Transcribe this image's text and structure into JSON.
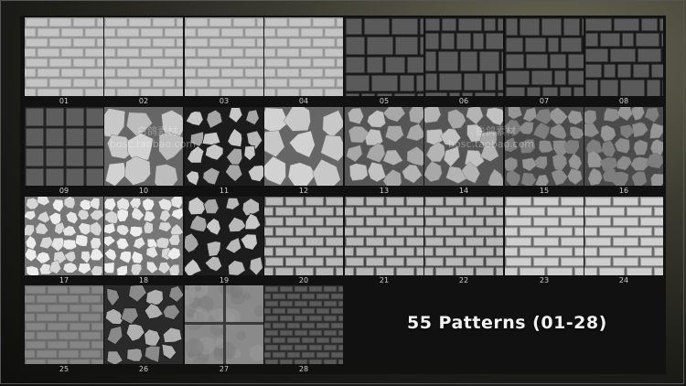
{
  "title": "55 Patterns (01-28)",
  "watermarks": [
    {
      "line1": "白鸽素材",
      "line2": "bosc.taobao.com"
    },
    {
      "line1": "白鸽素材",
      "line2": "bosc.taobao.com"
    }
  ],
  "patterns": [
    {
      "label": "01",
      "style": "brick-light"
    },
    {
      "label": "02",
      "style": "brick-light"
    },
    {
      "label": "03",
      "style": "brick-light"
    },
    {
      "label": "04",
      "style": "brick-light"
    },
    {
      "label": "05",
      "style": "block-dark"
    },
    {
      "label": "06",
      "style": "block-dark"
    },
    {
      "label": "07",
      "style": "block-dark"
    },
    {
      "label": "08",
      "style": "block-dark"
    },
    {
      "label": "09",
      "style": "square-dark"
    },
    {
      "label": "10",
      "style": "flagstone-large"
    },
    {
      "label": "11",
      "style": "cobble-dark-joints"
    },
    {
      "label": "12",
      "style": "flagstone-large"
    },
    {
      "label": "13",
      "style": "flagstone-medium"
    },
    {
      "label": "14",
      "style": "flagstone-medium"
    },
    {
      "label": "15",
      "style": "flagstone-gray"
    },
    {
      "label": "16",
      "style": "flagstone-gray"
    },
    {
      "label": "17",
      "style": "cobble-white"
    },
    {
      "label": "18",
      "style": "cobble-white"
    },
    {
      "label": "19",
      "style": "cobble-dark-joints"
    },
    {
      "label": "20",
      "style": "brick-embossed"
    },
    {
      "label": "21",
      "style": "brick-embossed"
    },
    {
      "label": "22",
      "style": "brick-embossed"
    },
    {
      "label": "23",
      "style": "brick-embossed-light"
    },
    {
      "label": "24",
      "style": "brick-embossed-light"
    },
    {
      "label": "25",
      "style": "brick-gray"
    },
    {
      "label": "26",
      "style": "river-stone"
    },
    {
      "label": "27",
      "style": "concrete-slab"
    },
    {
      "label": "28",
      "style": "brick-dark-small"
    }
  ]
}
